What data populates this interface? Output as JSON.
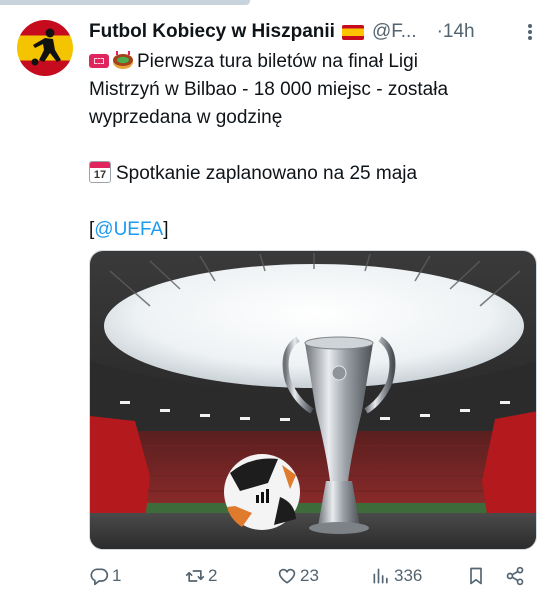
{
  "tweet": {
    "author_name": "Futbol Kobiecy w Hiszpanii",
    "handle": "@F...",
    "time": "·14h",
    "lines": [
      "Pierwsza tura biletów na finał Ligi",
      "Mistrzyń w Bilbao - 18 000 miejsc - została",
      "wyprzedana w godzinę"
    ],
    "date_line": "Spotkanie zaplanowano na 25 maja",
    "calendar_icon_month": "July",
    "calendar_icon_day": "17",
    "mention_open": "[",
    "mention": "@UEFA",
    "mention_close": "]",
    "media_alt": "Trophy and ball in stadium"
  },
  "actions": {
    "replies": "1",
    "reposts": "2",
    "likes": "23",
    "views": "336"
  },
  "colors": {
    "accent": "#1d9bf0",
    "secondary_text": "#536471",
    "primary_text": "#0f1419"
  },
  "icons": [
    "ticket-icon",
    "stadium-icon",
    "calendar-icon",
    "reply-icon",
    "repost-icon",
    "like-icon",
    "views-icon",
    "bookmark-icon",
    "share-icon",
    "more-icon"
  ]
}
